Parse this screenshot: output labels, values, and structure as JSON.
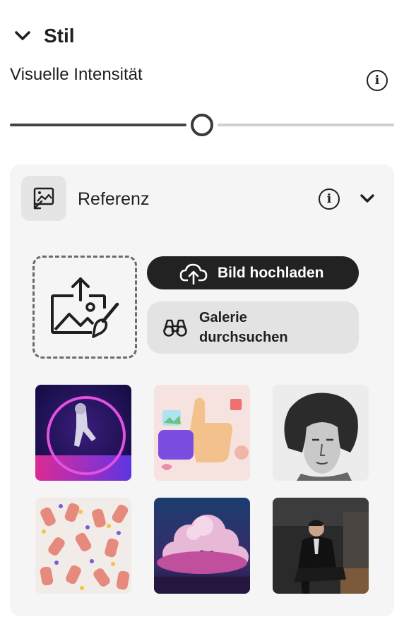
{
  "section": {
    "title": "Stil"
  },
  "intensity": {
    "label": "Visuelle Intensität",
    "value_fraction": 0.5
  },
  "reference": {
    "title": "Referenz",
    "upload_button_label": "Bild hochladen",
    "gallery_button_line1": "Galerie",
    "gallery_button_line2": "durchsuchen"
  },
  "thumbnails": [
    {
      "subject": "astronaut in neon ring"
    },
    {
      "subject": "3D thumbs up hand"
    },
    {
      "subject": "engraved portrait"
    },
    {
      "subject": "hands pattern illustration"
    },
    {
      "subject": "pink clouds"
    },
    {
      "subject": "man in suit portrait"
    }
  ],
  "icons": {
    "collapse": "chevron-down-icon",
    "info": "info-icon",
    "reference": "image-reference-icon",
    "upload_art": "image-upload-brush-icon",
    "cloud_upload": "cloud-upload-icon",
    "binoculars": "binoculars-icon"
  },
  "colors": {
    "primary_button": "#222222",
    "panel": "#f5f5f5",
    "secondary_button": "#e3e3e3"
  }
}
